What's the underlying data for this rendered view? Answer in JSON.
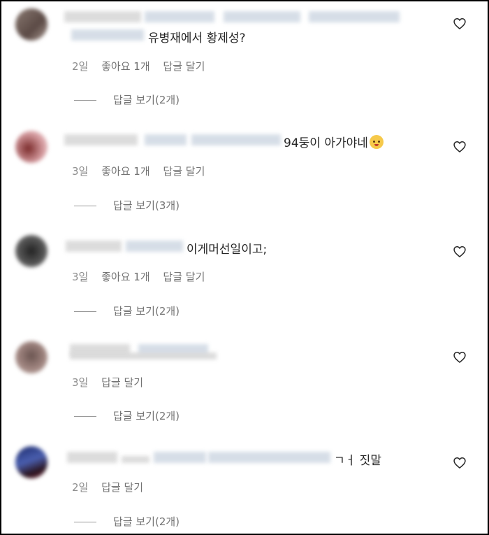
{
  "comments": [
    {
      "text": "유병재에서 황제성?",
      "age": "2일",
      "likes": "좋아요 1개",
      "reply": "답글 달기",
      "view_replies": "답글 보기(2개)"
    },
    {
      "text": "94둥이 아가야네",
      "age": "3일",
      "likes": "좋아요 1개",
      "reply": "답글 달기",
      "view_replies": "답글 보기(3개)"
    },
    {
      "text": "이게머선일이고;",
      "age": "3일",
      "likes": "좋아요 1개",
      "reply": "답글 달기",
      "view_replies": "답글 보기(2개)"
    },
    {
      "text": "",
      "age": "3일",
      "likes": "",
      "reply": "답글 달기",
      "view_replies": "답글 보기(2개)"
    },
    {
      "text": "ㄱㅓ 짓말",
      "age": "2일",
      "likes": "",
      "reply": "답글 달기",
      "view_replies": "답글 보기(2개)"
    }
  ],
  "icons": {
    "like": "heart-icon",
    "emoji": "baby-face-emoji"
  },
  "colors": {
    "text": "#262626",
    "meta": "#8e8e8e",
    "redacted": "#cfd8e3"
  }
}
